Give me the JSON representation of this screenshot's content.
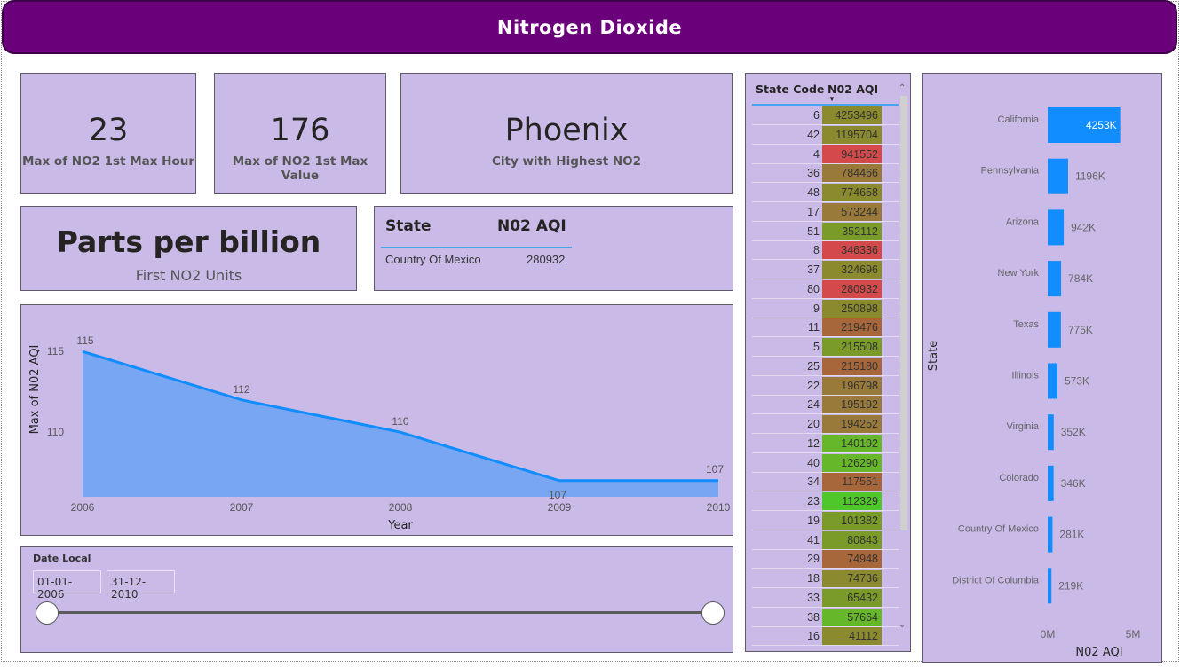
{
  "header": {
    "title": "Nitrogen Dioxide"
  },
  "cards": [
    {
      "value": "23",
      "label": "Max of NO2 1st Max Hour"
    },
    {
      "value": "176",
      "label": "Max of NO2 1st Max Value"
    },
    {
      "value": "Phoenix",
      "label": "City with Highest NO2"
    },
    {
      "value": "Parts per billion",
      "label": "First NO2 Units"
    }
  ],
  "state_table": {
    "col1": "State",
    "col2": "N02 AQI",
    "row": {
      "state": "Country Of Mexico",
      "value": "280932"
    }
  },
  "line_chart": {
    "ylabel": "Max of N02 AQI",
    "xlabel": "Year",
    "y_ticks": [
      "115",
      "110"
    ]
  },
  "chart_data": [
    {
      "type": "area",
      "x": [
        "2006",
        "2007",
        "2008",
        "2009",
        "2010"
      ],
      "series": [
        {
          "values": [
            115,
            112,
            110,
            107,
            107
          ]
        }
      ],
      "xlabel": "Year",
      "ylabel": "Max of N02 AQI",
      "ylim": [
        106,
        116
      ],
      "color": "#118dff",
      "fill": "#79a6f2"
    },
    {
      "type": "bar",
      "orientation": "horizontal",
      "categories": [
        "California",
        "Pennsylvania",
        "Arizona",
        "New York",
        "Texas",
        "Illinois",
        "Virginia",
        "Colorado",
        "Country Of Mexico",
        "District Of Columbia"
      ],
      "values": [
        4253496,
        1195704,
        941552,
        784466,
        774658,
        573244,
        352112,
        346336,
        280932,
        219476
      ],
      "labels": [
        "4253K",
        "1196K",
        "942K",
        "784K",
        "775K",
        "573K",
        "352K",
        "346K",
        "281K",
        "219K"
      ],
      "xlabel": "N02 AQI",
      "ylabel": "State",
      "x_ticks": [
        "0M",
        "5M"
      ],
      "xlim": [
        0,
        5000000
      ],
      "color": "#118dff"
    }
  ],
  "slicer": {
    "title": "Date Local",
    "start": "01-01-2006",
    "end": "31-12-2010",
    "range": [
      0,
      1
    ]
  },
  "code_table": {
    "col1": "State Code",
    "col2": "N02 AQI",
    "sort_icon": "sort-descending-icon",
    "rows": [
      {
        "code": "6",
        "aqi": "4253496",
        "color": "#8b8a2e"
      },
      {
        "code": "42",
        "aqi": "1195704",
        "color": "#8b8a2e"
      },
      {
        "code": "4",
        "aqi": "941552",
        "color": "#d44a4a"
      },
      {
        "code": "36",
        "aqi": "784466",
        "color": "#9a7a3a"
      },
      {
        "code": "48",
        "aqi": "774658",
        "color": "#8b8a2e"
      },
      {
        "code": "17",
        "aqi": "573244",
        "color": "#9a7a3a"
      },
      {
        "code": "51",
        "aqi": "352112",
        "color": "#7a9a2a"
      },
      {
        "code": "8",
        "aqi": "346336",
        "color": "#d44a4a"
      },
      {
        "code": "37",
        "aqi": "324696",
        "color": "#8b8a2e"
      },
      {
        "code": "80",
        "aqi": "280932",
        "color": "#d44a4a"
      },
      {
        "code": "9",
        "aqi": "250898",
        "color": "#8b8a2e"
      },
      {
        "code": "11",
        "aqi": "219476",
        "color": "#a8673a"
      },
      {
        "code": "5",
        "aqi": "215508",
        "color": "#7a9a2a"
      },
      {
        "code": "25",
        "aqi": "215180",
        "color": "#a8673a"
      },
      {
        "code": "22",
        "aqi": "196798",
        "color": "#9a7a3a"
      },
      {
        "code": "24",
        "aqi": "195192",
        "color": "#9a7a3a"
      },
      {
        "code": "20",
        "aqi": "194252",
        "color": "#9a7a3a"
      },
      {
        "code": "12",
        "aqi": "140192",
        "color": "#66b82a"
      },
      {
        "code": "40",
        "aqi": "126290",
        "color": "#66b82a"
      },
      {
        "code": "34",
        "aqi": "117551",
        "color": "#a8673a"
      },
      {
        "code": "23",
        "aqi": "112329",
        "color": "#4fc72a"
      },
      {
        "code": "19",
        "aqi": "101382",
        "color": "#7a9a2a"
      },
      {
        "code": "41",
        "aqi": "80843",
        "color": "#7a9a2a"
      },
      {
        "code": "29",
        "aqi": "74948",
        "color": "#a8673a"
      },
      {
        "code": "18",
        "aqi": "74736",
        "color": "#8b8a2e"
      },
      {
        "code": "33",
        "aqi": "65432",
        "color": "#7a9a2a"
      },
      {
        "code": "38",
        "aqi": "57664",
        "color": "#66b82a"
      },
      {
        "code": "16",
        "aqi": "41112",
        "color": "#8b8a2e"
      }
    ]
  }
}
